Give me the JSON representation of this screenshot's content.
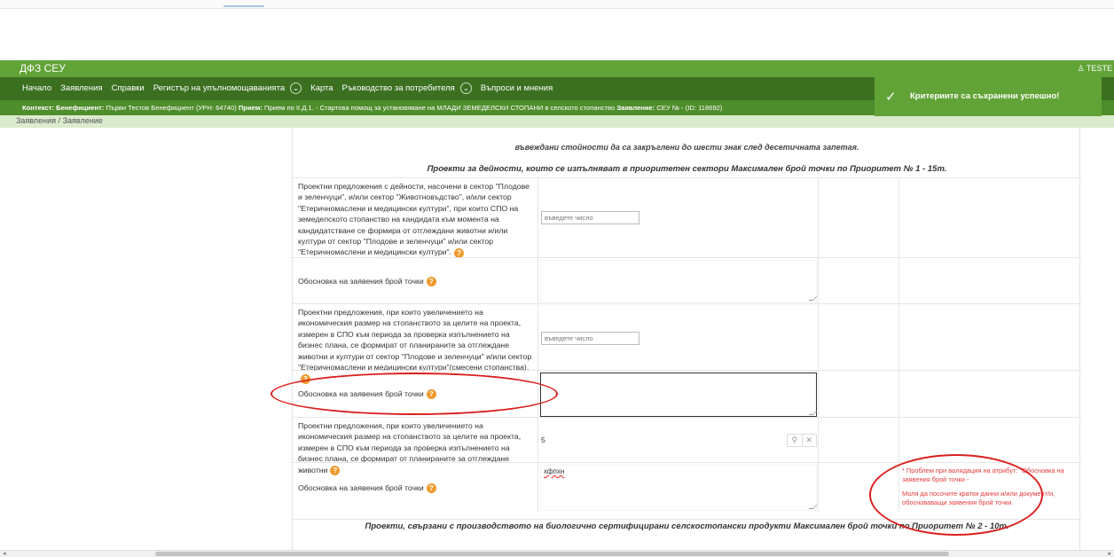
{
  "app": {
    "brand": "ДФЗ СЕУ",
    "user": "TESTE"
  },
  "nav": {
    "items": [
      "Начало",
      "Заявления",
      "Справки",
      "Регистър на упълномощаванията",
      "Карта",
      "Ръководство за потребителя",
      "Въпроси и мнения"
    ],
    "chevron_icon": "chevron-down-icon"
  },
  "context": {
    "label_context": "Контекст:",
    "label_beneficiary": "Бенефициент:",
    "beneficiary": "Първи Тестов Бенефициент (УРН: 64740)",
    "label_call": "Прием:",
    "call": "Прием по II.Д.1. - Стартова помощ за установяване на МЛАДИ ЗЕМЕДЕЛСКИ СТОПАНИ в селското стопанство",
    "label_application": "Заявление:",
    "application": "СЕУ № - (ID: 118692)"
  },
  "breadcrumb": {
    "root": "Заявления",
    "separator": "/",
    "current": "Заявление"
  },
  "toast": {
    "message": "Критериите са съхранени успешно!",
    "icon": "check-icon"
  },
  "form": {
    "note": "въвеждани стойности да са закръглени до шести знак след десетичната запетая.",
    "section1_title": "Проекти за дейности, които се изпълняват в приоритетен сектори Максимален брой точки по Приоритет № 1 - 15т.",
    "rows": {
      "r1": {
        "label": "Проектни предложения с дейности, насочени в сектор \"Плодове и зеленчуци\", и/или сектор \"Животновъдство\", и/или сектор \"Етеричномаслени и медицински култури\", при които СПО на земеделското стопанство на кандидата към момента на кандидатстване се формира от отглеждани животни и/или култури от сектор \"Плодове и зеленчуци\" и/или сектор \"Етеричномаслени и медицински култури\".",
        "placeholder": "въведете число"
      },
      "r2": {
        "label": "Обосновка на заявения брой точки"
      },
      "r3": {
        "label": "Проектни предложения, при които увеличението на икономическия размер на стопанството за целите на проекта, измерен в СПО към периода за проверка изпълнението на бизнес плана, се формират от планираните за отглеждане животни и култури от сектор \"Плодове и зеленчуци\" и/или сектор \"Етеричномаслени и медицински култури\"(смесени стопанства).",
        "placeholder": "въведете число"
      },
      "r4": {
        "label": "Обосновка на заявения брой точки"
      },
      "r5": {
        "label": "Проектни предложения, при които увеличението на икономическия размер на стопанството за целите на проекта, измерен в СПО към периода за проверка изпълнението на бизнес плана, се формират от планираните за отглеждане животни",
        "value": "5"
      },
      "r6": {
        "label": "Обосновка на заявения брой точки",
        "value": "хфпхн",
        "error1": "* Проблем при валидация на атрибут: \"Обосновка на заявения брой точки -",
        "error2": "Моля да посочите кратки данни и/или документ/и, обосноваващи заявения брой точки."
      }
    },
    "section2_title": "Проекти, свързани с производството на биологично сертифицирани селскостопански продукти Максимален брой точки по Приоритет № 2 - 10т."
  },
  "icons": {
    "info": "info-icon",
    "search": "search-icon",
    "clear": "close-icon",
    "user": "user-icon"
  },
  "annotation_color": "#d9201e"
}
